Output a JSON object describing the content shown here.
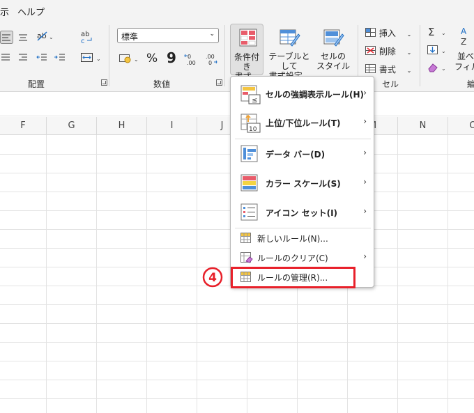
{
  "menu_tabs": [
    "示",
    "ヘルプ"
  ],
  "ribbon": {
    "number_format": {
      "value": "標準"
    },
    "groups": {
      "alignment": "配置",
      "number": "数値",
      "cells": "セル",
      "editing_partial": "編"
    },
    "conditional_format": {
      "line1": "条件付き",
      "line2": "書式"
    },
    "table_format": {
      "line1": "テーブルとして",
      "line2": "書式設定"
    },
    "cell_style": {
      "line1": "セルの",
      "line2": "スタイル"
    },
    "insert": "挿入",
    "delete": "削除",
    "format": "書式",
    "sort_line1": "並べ",
    "sort_line2": "フィル",
    "percent": "%",
    "comma": "9"
  },
  "columns": [
    "F",
    "G",
    "H",
    "I",
    "J",
    "M",
    "N",
    "O"
  ],
  "dropdown": {
    "items": [
      {
        "label": "セルの強調表示ルール(H)",
        "submenu": true
      },
      {
        "label": "上位/下位ルール(T)",
        "submenu": true
      },
      {
        "label": "データ バー(D)",
        "submenu": true
      },
      {
        "label": "カラー スケール(S)",
        "submenu": true
      },
      {
        "label": "アイコン セット(I)",
        "submenu": true
      },
      {
        "label": "新しいルール(N)...",
        "submenu": false
      },
      {
        "label": "ルールのクリア(C)",
        "submenu": true
      },
      {
        "label": "ルールの管理(R)...",
        "submenu": false
      }
    ],
    "top_bottom_icon_number": "10"
  },
  "annotation": {
    "step_number": "4",
    "color": "#e8202a"
  }
}
